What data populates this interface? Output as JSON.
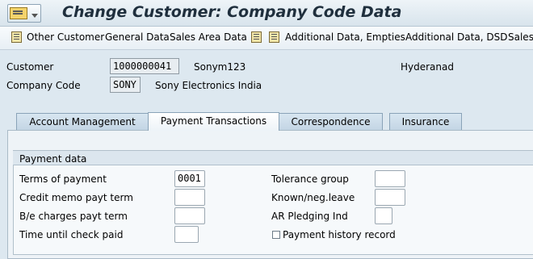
{
  "title": "Change Customer: Company Code Data",
  "toolbar": {
    "other_customer": "Other Customer",
    "general_data": "General Data",
    "sales_area_data": "Sales Area Data",
    "additional_data_empties": "Additional Data, Empties",
    "additional_data_dsd": "Additional Data, DSD",
    "sales_truncated": "Sales"
  },
  "header": {
    "customer_label": "Customer",
    "customer_value": "1000000041",
    "customer_name": "Sonym123",
    "city": "Hyderanad",
    "company_code_label": "Company Code",
    "company_code_value": "SONY",
    "company_name": "Sony Electronics India"
  },
  "tabs": [
    {
      "label": "Account Management",
      "active": false
    },
    {
      "label": "Payment Transactions",
      "active": true
    },
    {
      "label": "Correspondence",
      "active": false
    },
    {
      "label": "Insurance",
      "active": false
    }
  ],
  "payment": {
    "group_title": "Payment data",
    "terms_label": "Terms of payment",
    "terms_value": "0001",
    "credit_memo_label": "Credit memo payt term",
    "credit_memo_value": "",
    "be_charges_label": "B/e charges payt term",
    "be_charges_value": "",
    "time_check_label": "Time until check paid",
    "time_check_value": "",
    "tolerance_label": "Tolerance group",
    "tolerance_value": "",
    "known_leave_label": "Known/neg.leave",
    "known_leave_value": "",
    "ar_pledging_label": "AR Pledging Ind",
    "ar_pledging_value": "",
    "history_label": "Payment history record",
    "history_checked": false
  },
  "icons": [
    "menu-icon",
    "other-customer-icon",
    "document-icon",
    "document-arrow-icon"
  ]
}
